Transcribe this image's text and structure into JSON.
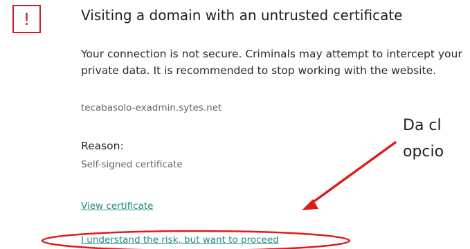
{
  "dialog": {
    "icon": "exclamation-icon",
    "icon_glyph": "!",
    "accent_color": "#c8202a",
    "link_color": "#218a84",
    "title": "Visiting a domain with an untrusted certificate",
    "message": "Your connection is not secure. Criminals may attempt to intercept your private data. It is recommended to stop working with the website.",
    "domain": "tecabasolo-exadmin.sytes.net",
    "reason_label": "Reason:",
    "reason_value": "Self-signed certificate",
    "view_certificate_link": "View certificate",
    "proceed_link": "I understand the risk, but want to proceed"
  },
  "annotation": {
    "line1": "Da cl",
    "line2": "opcio",
    "color": "#e01b1b"
  }
}
